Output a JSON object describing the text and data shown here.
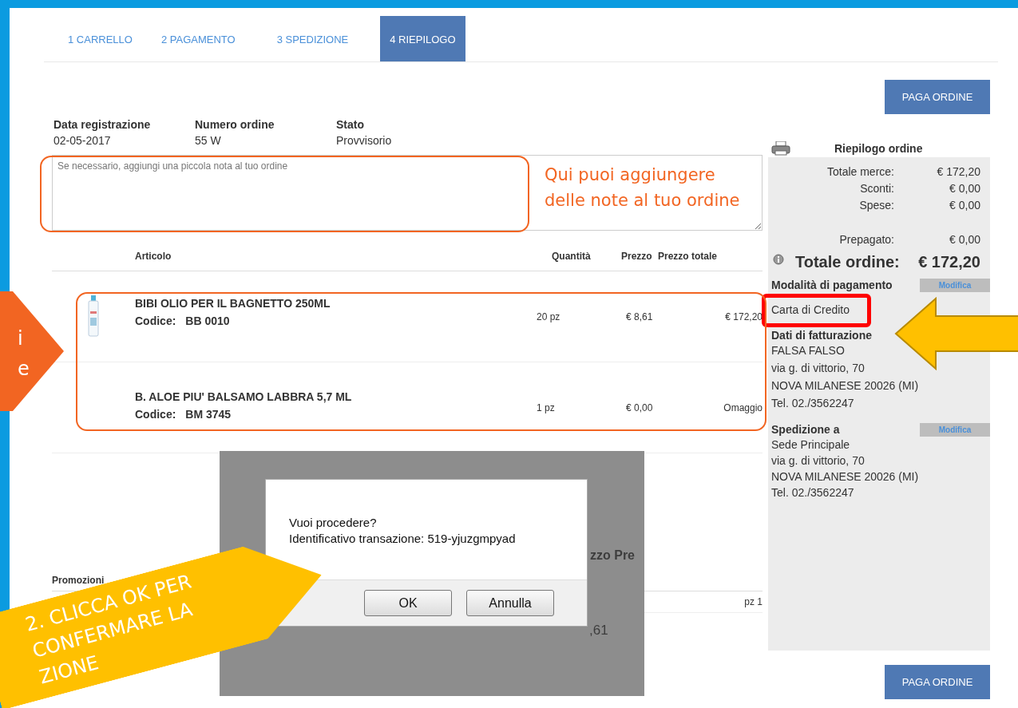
{
  "tabs": [
    {
      "label": "1 CARRELLO",
      "selected": false
    },
    {
      "label": "2 PAGAMENTO",
      "selected": false
    },
    {
      "label": "3 SPEDIZIONE",
      "selected": false
    },
    {
      "label": "4 RIEPILOGO",
      "selected": true
    }
  ],
  "pay_buttons": [
    "PAGA ORDINE",
    "PAGA ORDINE"
  ],
  "order_info": [
    {
      "label": "Data registrazione",
      "value": "02-05-2017"
    },
    {
      "label": "Numero ordine",
      "value": "55 W"
    },
    {
      "label": "Stato",
      "value": "Provvisorio"
    }
  ],
  "notes": {
    "placeholder": "Se necessario, aggiungi una piccola nota al tuo ordine"
  },
  "items_table": {
    "columns": [
      "Articolo",
      "Quantità",
      "Prezzo",
      "Prezzo totale"
    ],
    "rows": [
      {
        "name": "BIBI OLIO PER IL BAGNETTO 250ML",
        "code_label": "Codice:",
        "code": "BB 0010",
        "has_image": true,
        "quantity": "20 pz",
        "price": "€ 8,61",
        "total": "€ 172,20"
      },
      {
        "name": "B. ALOE PIU' BALSAMO LABBRA 5,7 ML",
        "code_label": "Codice:",
        "code": "BM 3745",
        "has_image": false,
        "quantity": "1 pz",
        "price": "€ 0,00",
        "total": "Omaggio"
      }
    ]
  },
  "promotions": {
    "title": "Promozioni",
    "row_value": "pz 1"
  },
  "summary": {
    "title": "Riepilogo ordine",
    "lines": [
      {
        "label": "Totale merce:",
        "value": "€ 172,20"
      },
      {
        "label": "Sconti:",
        "value": "€ 0,00"
      },
      {
        "label": "Spese:",
        "value": "€ 0,00"
      }
    ],
    "prepaid": {
      "label": "Prepagato:",
      "value": "€ 0,00"
    },
    "total": {
      "label": "Totale ordine:",
      "value": "€ 172,20"
    },
    "payment": {
      "title": "Modalità di pagamento",
      "edit": "Modifica",
      "method": "Carta di Credito"
    },
    "billing": {
      "title": "Dati di fatturazione",
      "lines": [
        "FALSA FALSO",
        "via g. di vittorio, 70",
        "NOVA MILANESE 20026 (MI)",
        "Tel. 02./3562247"
      ]
    },
    "shipping": {
      "title": "Spedizione a",
      "edit": "Modifica",
      "lines": [
        "Sede Principale",
        "via g. di vittorio, 70",
        "NOVA MILANESE 20026 (MI)",
        "Tel. 02./3562247"
      ]
    }
  },
  "backdrop_fragments": [
    "zzo Pre",
    ",61"
  ],
  "dialog": {
    "lines": [
      "Vuoi procedere?",
      "Identificativo transazione: 519-yjuzgmpyad"
    ],
    "buttons": [
      "OK",
      "Annulla"
    ]
  },
  "annotations": {
    "notes_hint": "Qui puoi aggiungere delle note al tuo ordine",
    "left_callout": [
      "i",
      "e"
    ],
    "bottom_callout": [
      "2. CLICCA OK PER",
      "CONFERMARE LA",
      "ZIONE"
    ]
  }
}
